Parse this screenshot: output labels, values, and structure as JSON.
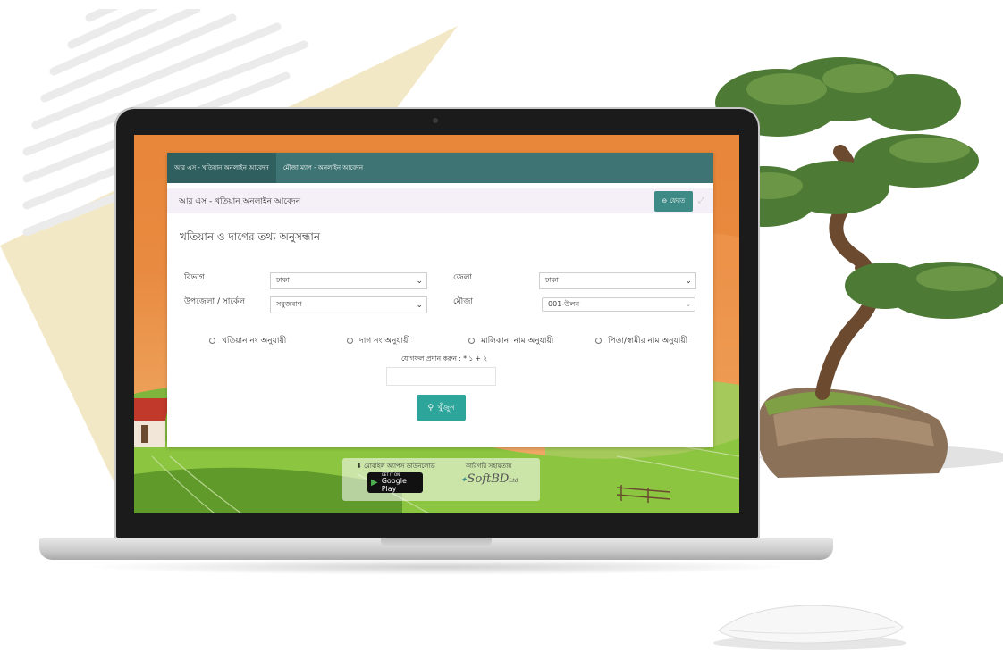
{
  "nav": {
    "tab1": "আর এস - খতিয়ান অনলাইন আবেদন",
    "tab2": "মৌজা ম্যাপ - অনলাইন আবেদন"
  },
  "titlebar": {
    "title": "আর এস - খতিয়ান অনলাইন আবেদন",
    "back_label": "ফেরত"
  },
  "heading": "খতিয়ান ও দাগের তথ্য অনুসন্ধান",
  "form": {
    "division_label": "বিভাগ",
    "division_value": "ঢাকা",
    "district_label": "জেলা",
    "district_value": "ঢাকা",
    "upazila_label": "উপজেলা / সার্কেল",
    "upazila_value": "সবুজবাগ",
    "mouza_label": "মৌজা",
    "mouza_value": "001-উলন"
  },
  "search_options": [
    "খতিয়ান নং অনুযায়ী",
    "দাগ নং অনুযায়ী",
    "মালিকানা নাম অনুযায়ী",
    "পিতা/স্বামীর নাম অনুযায়ী"
  ],
  "captcha": {
    "label": "যোগফল প্রদান করুন : * ১ + ২"
  },
  "search_button": "খুঁজুন",
  "footer": {
    "download_label": "মোবাইল অ্যাপস ডাউনলোড",
    "store_small": "GET IT ON",
    "store_big": "Google Play",
    "tech_label": "কারিগরি সহায়তায়",
    "brand_name": "SoftBD",
    "brand_suffix": "Ltd"
  },
  "colors": {
    "nav_bg": "#3e7474",
    "accent": "#2ea59a",
    "screen_bg": "#e8863a"
  }
}
